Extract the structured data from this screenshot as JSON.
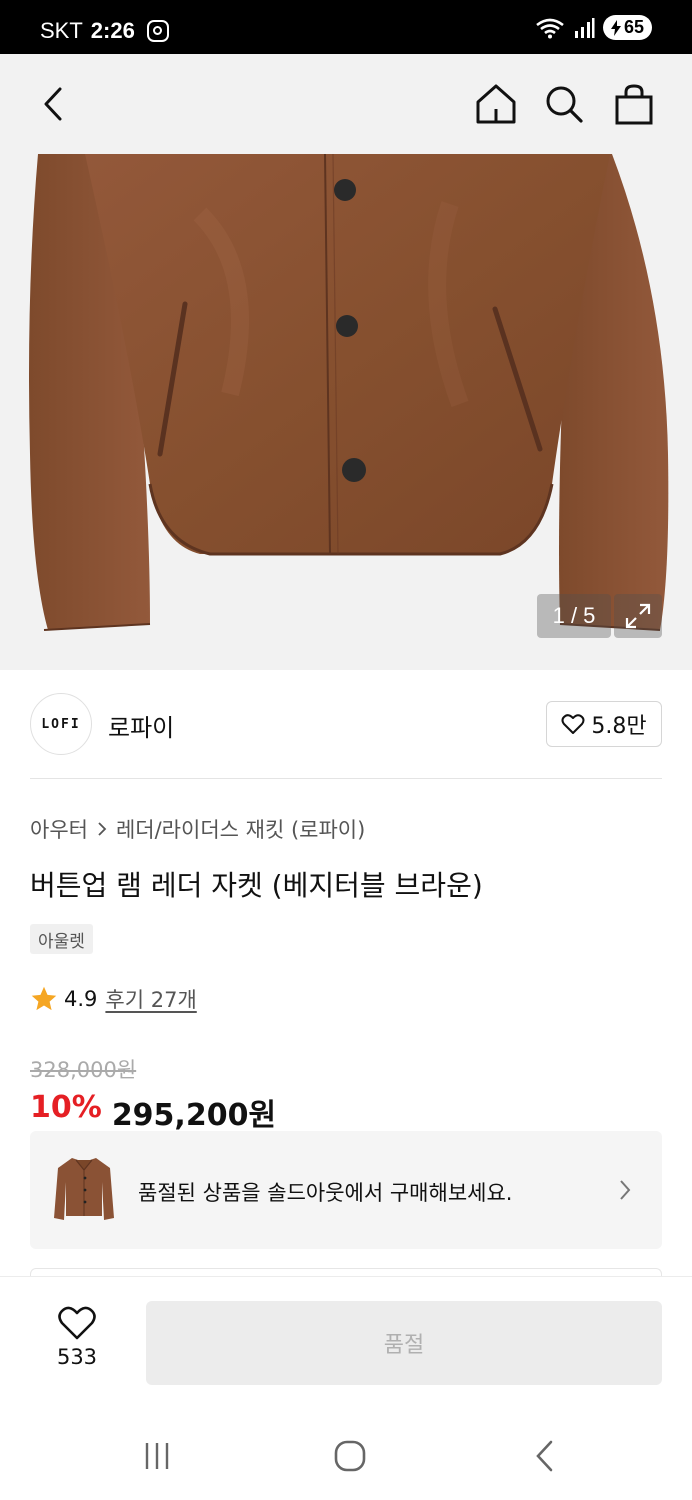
{
  "status_bar": {
    "carrier": "SKT",
    "time": "2:26",
    "battery": "65"
  },
  "nav": {
    "back_icon": "chevron-left-icon",
    "home_icon": "home-icon",
    "search_icon": "search-icon",
    "cart_icon": "shopping-bag-icon"
  },
  "gallery": {
    "counter": "1 / 5",
    "expand_icon": "expand-icon"
  },
  "brand": {
    "logo_text": "LOFI",
    "name": "로파이",
    "likes": "5.8만"
  },
  "product": {
    "breadcrumb": [
      "아우터",
      "레더/라이더스 재킷 (로파이)"
    ],
    "title": "버튼업 램 레더 자켓 (베지터블 브라운)",
    "badge": "아울렛",
    "rating": "4.9",
    "review_link": "후기 27개",
    "original_price": "328,000원",
    "discount": "10%",
    "price": "295,200원"
  },
  "soldout_banner": {
    "text": "품절된 상품을 솔드아웃에서 구매해보세요."
  },
  "bottom_bar": {
    "wish_count": "533",
    "action_label": "품절"
  },
  "colors": {
    "accent_red": "#e51f24",
    "jacket_brown": "#8a5235"
  }
}
